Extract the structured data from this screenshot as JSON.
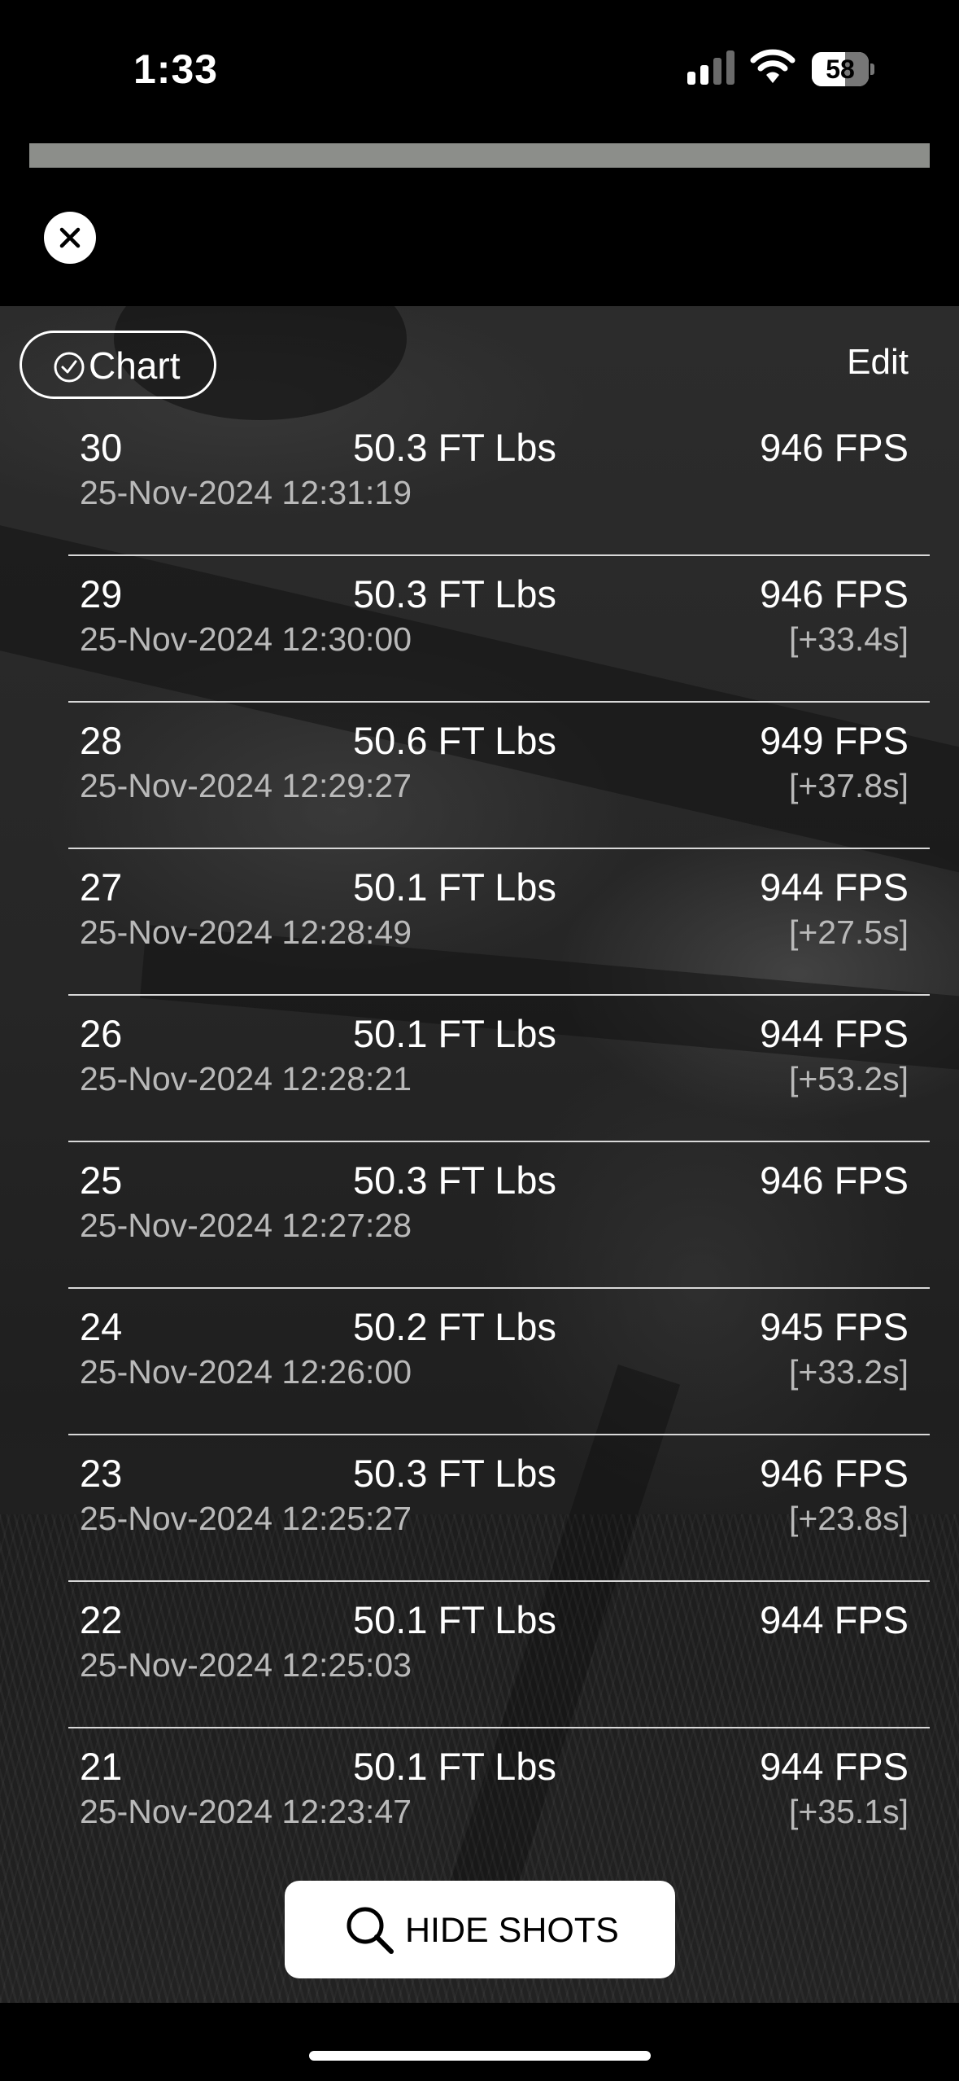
{
  "status_bar": {
    "time": "1:33",
    "battery_level": "58",
    "battery_fraction": 0.58,
    "signal_bars_active": 2,
    "signal_bars_total": 4,
    "icons": [
      "cellular-signal-icon",
      "wifi-icon",
      "battery-icon"
    ]
  },
  "modal": {
    "close_icon": "close-icon"
  },
  "toolbar": {
    "chart_label": "Chart",
    "chart_icon": "checkmark-circle-icon",
    "edit_label": "Edit"
  },
  "shots": [
    {
      "number": "30",
      "energy": "50.3 FT Lbs",
      "velocity": "946 FPS",
      "timestamp": "25-Nov-2024 12:31:19",
      "interval": ""
    },
    {
      "number": "29",
      "energy": "50.3 FT Lbs",
      "velocity": "946 FPS",
      "timestamp": "25-Nov-2024 12:30:00",
      "interval": "[+33.4s]"
    },
    {
      "number": "28",
      "energy": "50.6 FT Lbs",
      "velocity": "949 FPS",
      "timestamp": "25-Nov-2024 12:29:27",
      "interval": "[+37.8s]"
    },
    {
      "number": "27",
      "energy": "50.1 FT Lbs",
      "velocity": "944 FPS",
      "timestamp": "25-Nov-2024 12:28:49",
      "interval": "[+27.5s]"
    },
    {
      "number": "26",
      "energy": "50.1 FT Lbs",
      "velocity": "944 FPS",
      "timestamp": "25-Nov-2024 12:28:21",
      "interval": "[+53.2s]"
    },
    {
      "number": "25",
      "energy": "50.3 FT Lbs",
      "velocity": "946 FPS",
      "timestamp": "25-Nov-2024 12:27:28",
      "interval": ""
    },
    {
      "number": "24",
      "energy": "50.2 FT Lbs",
      "velocity": "945 FPS",
      "timestamp": "25-Nov-2024 12:26:00",
      "interval": "[+33.2s]"
    },
    {
      "number": "23",
      "energy": "50.3 FT Lbs",
      "velocity": "946 FPS",
      "timestamp": "25-Nov-2024 12:25:27",
      "interval": "[+23.8s]"
    },
    {
      "number": "22",
      "energy": "50.1 FT Lbs",
      "velocity": "944 FPS",
      "timestamp": "25-Nov-2024 12:25:03",
      "interval": ""
    },
    {
      "number": "21",
      "energy": "50.1 FT Lbs",
      "velocity": "944 FPS",
      "timestamp": "25-Nov-2024 12:23:47",
      "interval": "[+35.1s]"
    }
  ],
  "footer": {
    "hide_shots_label": "HIDE SHOTS",
    "hide_shots_icon": "search-icon"
  }
}
